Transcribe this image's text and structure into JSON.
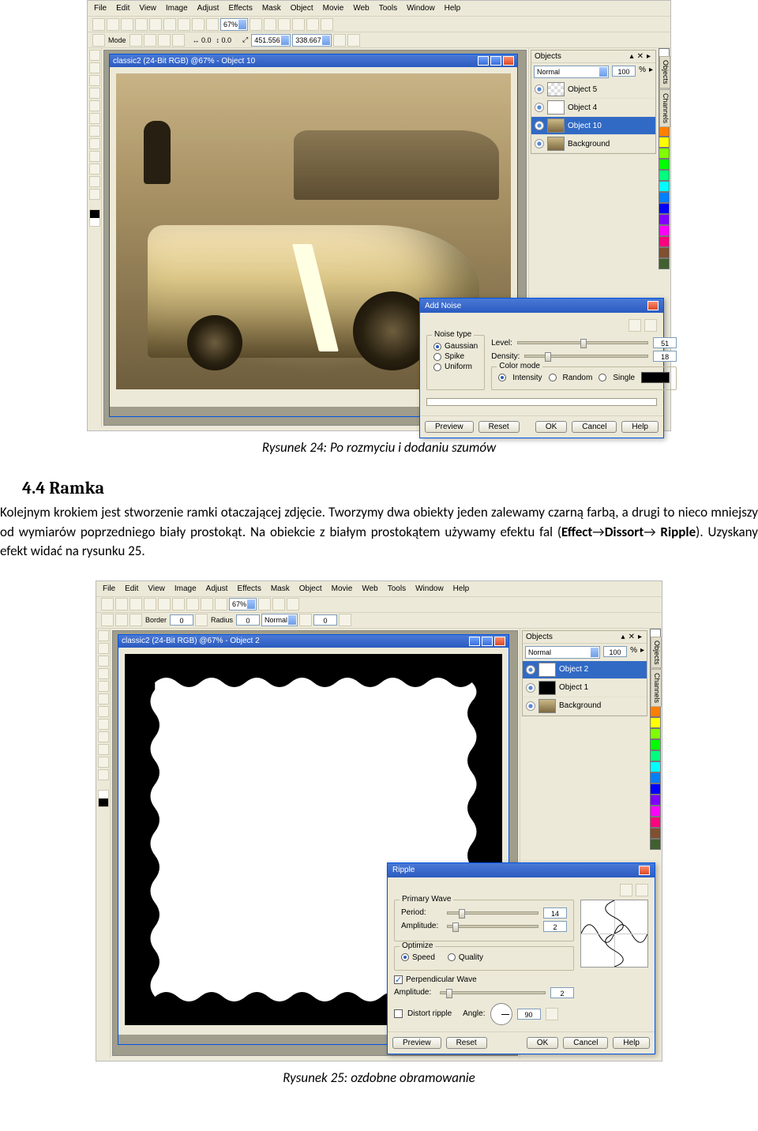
{
  "caption1": "Rysunek 24: Po rozmyciu i dodaniu szumów",
  "caption2": "Rysunek 25: ozdobne obramowanie",
  "section_num": "4.4",
  "section_title": "Ramka",
  "para_parts": {
    "p1": "Kolejnym krokiem jest stworzenie ramki otaczającej zdjęcie. Tworzymy dwa obiekty jeden zalewamy czarną farbą, a drugi to nieco mniejszy od wymiarów poprzedniego biały prostokąt. Na obiekcie z białym prostokątem  używamy efektu fal (",
    "b1": "Effect",
    "arr": "→",
    "b2": "Dissort",
    "b3a": " Ripple",
    "p2": "). Uzyskany efekt widać na rysunku 25."
  },
  "menu": [
    "File",
    "Edit",
    "View",
    "Image",
    "Adjust",
    "Effects",
    "Mask",
    "Object",
    "Movie",
    "Web",
    "Tools",
    "Window",
    "Help"
  ],
  "toolbar_zoom": "67%",
  "coords_a": "451.556",
  "coords_b": "338.667",
  "mode_label": "Mode",
  "doc_title1": "classic2 (24-Bit RGB) @67% - Object 10",
  "doc_title2": "classic2 (24-Bit RGB) @67% - Object 2",
  "panel": {
    "title": "Objects",
    "blend": "Normal",
    "opacity": "100",
    "pct": "%",
    "layers1": [
      "Object 5",
      "Object 4",
      "Object 10",
      "Background"
    ],
    "layers2": [
      "Object 2",
      "Object 1",
      "Background"
    ]
  },
  "vtabs": [
    "Objects",
    "Channels"
  ],
  "swatches": [
    "#ffffff",
    "#000000",
    "#7f7f7f",
    "#bfbfbf",
    "#590000",
    "#7f0000",
    "#ff0000",
    "#ff7f00",
    "#ffff00",
    "#7fff00",
    "#00ff00",
    "#00ff7f",
    "#00ffff",
    "#007fff",
    "#0000ff",
    "#7f00ff",
    "#ff00ff",
    "#ff007f",
    "#805030",
    "#406030"
  ],
  "addnoise": {
    "title": "Add Noise",
    "group_noise": "Noise type",
    "r_gauss": "Gaussian",
    "r_spike": "Spike",
    "r_uniform": "Uniform",
    "lbl_level": "Level:",
    "val_level": "51",
    "lbl_density": "Density:",
    "val_density": "18",
    "group_color": "Color mode",
    "r_intensity": "Intensity",
    "r_random": "Random",
    "r_single": "Single",
    "btn_preview": "Preview",
    "btn_reset": "Reset",
    "btn_ok": "OK",
    "btn_cancel": "Cancel",
    "btn_help": "Help"
  },
  "tb2": {
    "border_lbl": "Border",
    "border_val": "0",
    "radius_lbl": "Radius",
    "radius_val": "0",
    "combo": "Normal",
    "num0": "0"
  },
  "ripple": {
    "title": "Ripple",
    "group_primary": "Primary Wave",
    "lbl_period": "Period:",
    "val_period": "14",
    "lbl_amp": "Amplitude:",
    "val_amp": "2",
    "group_opt": "Optimize",
    "r_speed": "Speed",
    "r_quality": "Quality",
    "chk_perp": "Perpendicular Wave",
    "lbl_amp2": "Amplitude:",
    "val_amp2": "2",
    "chk_distort": "Distort ripple",
    "lbl_angle": "Angle:",
    "val_angle": "90",
    "btn_preview": "Preview",
    "btn_reset": "Reset",
    "btn_ok": "OK",
    "btn_cancel": "Cancel",
    "btn_help": "Help"
  }
}
